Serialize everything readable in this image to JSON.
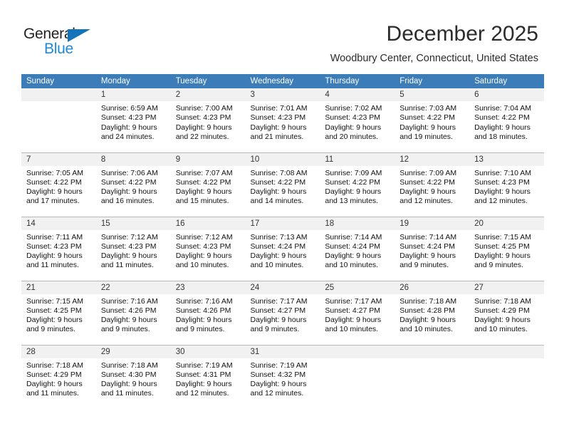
{
  "brand": {
    "name_top": "General",
    "name_bottom": "Blue",
    "triangle_color": "#1573b9",
    "blue_color": "#1c8ad6"
  },
  "header": {
    "month_title": "December 2025",
    "location": "Woodbury Center, Connecticut, United States",
    "header_bg": "#3b7cb9",
    "daynum_bg": "#f1f1f1"
  },
  "weekdays": [
    "Sunday",
    "Monday",
    "Tuesday",
    "Wednesday",
    "Thursday",
    "Friday",
    "Saturday"
  ],
  "weeks": [
    [
      {
        "day": "",
        "sunrise": "",
        "sunset": "",
        "daylight_line1": "",
        "daylight_line2": ""
      },
      {
        "day": "1",
        "sunrise": "Sunrise: 6:59 AM",
        "sunset": "Sunset: 4:23 PM",
        "daylight_line1": "Daylight: 9 hours",
        "daylight_line2": "and 24 minutes."
      },
      {
        "day": "2",
        "sunrise": "Sunrise: 7:00 AM",
        "sunset": "Sunset: 4:23 PM",
        "daylight_line1": "Daylight: 9 hours",
        "daylight_line2": "and 22 minutes."
      },
      {
        "day": "3",
        "sunrise": "Sunrise: 7:01 AM",
        "sunset": "Sunset: 4:23 PM",
        "daylight_line1": "Daylight: 9 hours",
        "daylight_line2": "and 21 minutes."
      },
      {
        "day": "4",
        "sunrise": "Sunrise: 7:02 AM",
        "sunset": "Sunset: 4:23 PM",
        "daylight_line1": "Daylight: 9 hours",
        "daylight_line2": "and 20 minutes."
      },
      {
        "day": "5",
        "sunrise": "Sunrise: 7:03 AM",
        "sunset": "Sunset: 4:22 PM",
        "daylight_line1": "Daylight: 9 hours",
        "daylight_line2": "and 19 minutes."
      },
      {
        "day": "6",
        "sunrise": "Sunrise: 7:04 AM",
        "sunset": "Sunset: 4:22 PM",
        "daylight_line1": "Daylight: 9 hours",
        "daylight_line2": "and 18 minutes."
      }
    ],
    [
      {
        "day": "7",
        "sunrise": "Sunrise: 7:05 AM",
        "sunset": "Sunset: 4:22 PM",
        "daylight_line1": "Daylight: 9 hours",
        "daylight_line2": "and 17 minutes."
      },
      {
        "day": "8",
        "sunrise": "Sunrise: 7:06 AM",
        "sunset": "Sunset: 4:22 PM",
        "daylight_line1": "Daylight: 9 hours",
        "daylight_line2": "and 16 minutes."
      },
      {
        "day": "9",
        "sunrise": "Sunrise: 7:07 AM",
        "sunset": "Sunset: 4:22 PM",
        "daylight_line1": "Daylight: 9 hours",
        "daylight_line2": "and 15 minutes."
      },
      {
        "day": "10",
        "sunrise": "Sunrise: 7:08 AM",
        "sunset": "Sunset: 4:22 PM",
        "daylight_line1": "Daylight: 9 hours",
        "daylight_line2": "and 14 minutes."
      },
      {
        "day": "11",
        "sunrise": "Sunrise: 7:09 AM",
        "sunset": "Sunset: 4:22 PM",
        "daylight_line1": "Daylight: 9 hours",
        "daylight_line2": "and 13 minutes."
      },
      {
        "day": "12",
        "sunrise": "Sunrise: 7:09 AM",
        "sunset": "Sunset: 4:22 PM",
        "daylight_line1": "Daylight: 9 hours",
        "daylight_line2": "and 12 minutes."
      },
      {
        "day": "13",
        "sunrise": "Sunrise: 7:10 AM",
        "sunset": "Sunset: 4:23 PM",
        "daylight_line1": "Daylight: 9 hours",
        "daylight_line2": "and 12 minutes."
      }
    ],
    [
      {
        "day": "14",
        "sunrise": "Sunrise: 7:11 AM",
        "sunset": "Sunset: 4:23 PM",
        "daylight_line1": "Daylight: 9 hours",
        "daylight_line2": "and 11 minutes."
      },
      {
        "day": "15",
        "sunrise": "Sunrise: 7:12 AM",
        "sunset": "Sunset: 4:23 PM",
        "daylight_line1": "Daylight: 9 hours",
        "daylight_line2": "and 11 minutes."
      },
      {
        "day": "16",
        "sunrise": "Sunrise: 7:12 AM",
        "sunset": "Sunset: 4:23 PM",
        "daylight_line1": "Daylight: 9 hours",
        "daylight_line2": "and 10 minutes."
      },
      {
        "day": "17",
        "sunrise": "Sunrise: 7:13 AM",
        "sunset": "Sunset: 4:24 PM",
        "daylight_line1": "Daylight: 9 hours",
        "daylight_line2": "and 10 minutes."
      },
      {
        "day": "18",
        "sunrise": "Sunrise: 7:14 AM",
        "sunset": "Sunset: 4:24 PM",
        "daylight_line1": "Daylight: 9 hours",
        "daylight_line2": "and 10 minutes."
      },
      {
        "day": "19",
        "sunrise": "Sunrise: 7:14 AM",
        "sunset": "Sunset: 4:24 PM",
        "daylight_line1": "Daylight: 9 hours",
        "daylight_line2": "and 9 minutes."
      },
      {
        "day": "20",
        "sunrise": "Sunrise: 7:15 AM",
        "sunset": "Sunset: 4:25 PM",
        "daylight_line1": "Daylight: 9 hours",
        "daylight_line2": "and 9 minutes."
      }
    ],
    [
      {
        "day": "21",
        "sunrise": "Sunrise: 7:15 AM",
        "sunset": "Sunset: 4:25 PM",
        "daylight_line1": "Daylight: 9 hours",
        "daylight_line2": "and 9 minutes."
      },
      {
        "day": "22",
        "sunrise": "Sunrise: 7:16 AM",
        "sunset": "Sunset: 4:26 PM",
        "daylight_line1": "Daylight: 9 hours",
        "daylight_line2": "and 9 minutes."
      },
      {
        "day": "23",
        "sunrise": "Sunrise: 7:16 AM",
        "sunset": "Sunset: 4:26 PM",
        "daylight_line1": "Daylight: 9 hours",
        "daylight_line2": "and 9 minutes."
      },
      {
        "day": "24",
        "sunrise": "Sunrise: 7:17 AM",
        "sunset": "Sunset: 4:27 PM",
        "daylight_line1": "Daylight: 9 hours",
        "daylight_line2": "and 9 minutes."
      },
      {
        "day": "25",
        "sunrise": "Sunrise: 7:17 AM",
        "sunset": "Sunset: 4:27 PM",
        "daylight_line1": "Daylight: 9 hours",
        "daylight_line2": "and 10 minutes."
      },
      {
        "day": "26",
        "sunrise": "Sunrise: 7:18 AM",
        "sunset": "Sunset: 4:28 PM",
        "daylight_line1": "Daylight: 9 hours",
        "daylight_line2": "and 10 minutes."
      },
      {
        "day": "27",
        "sunrise": "Sunrise: 7:18 AM",
        "sunset": "Sunset: 4:29 PM",
        "daylight_line1": "Daylight: 9 hours",
        "daylight_line2": "and 10 minutes."
      }
    ],
    [
      {
        "day": "28",
        "sunrise": "Sunrise: 7:18 AM",
        "sunset": "Sunset: 4:29 PM",
        "daylight_line1": "Daylight: 9 hours",
        "daylight_line2": "and 11 minutes."
      },
      {
        "day": "29",
        "sunrise": "Sunrise: 7:18 AM",
        "sunset": "Sunset: 4:30 PM",
        "daylight_line1": "Daylight: 9 hours",
        "daylight_line2": "and 11 minutes."
      },
      {
        "day": "30",
        "sunrise": "Sunrise: 7:19 AM",
        "sunset": "Sunset: 4:31 PM",
        "daylight_line1": "Daylight: 9 hours",
        "daylight_line2": "and 12 minutes."
      },
      {
        "day": "31",
        "sunrise": "Sunrise: 7:19 AM",
        "sunset": "Sunset: 4:32 PM",
        "daylight_line1": "Daylight: 9 hours",
        "daylight_line2": "and 12 minutes."
      },
      {
        "day": "",
        "sunrise": "",
        "sunset": "",
        "daylight_line1": "",
        "daylight_line2": ""
      },
      {
        "day": "",
        "sunrise": "",
        "sunset": "",
        "daylight_line1": "",
        "daylight_line2": ""
      },
      {
        "day": "",
        "sunrise": "",
        "sunset": "",
        "daylight_line1": "",
        "daylight_line2": ""
      }
    ]
  ]
}
